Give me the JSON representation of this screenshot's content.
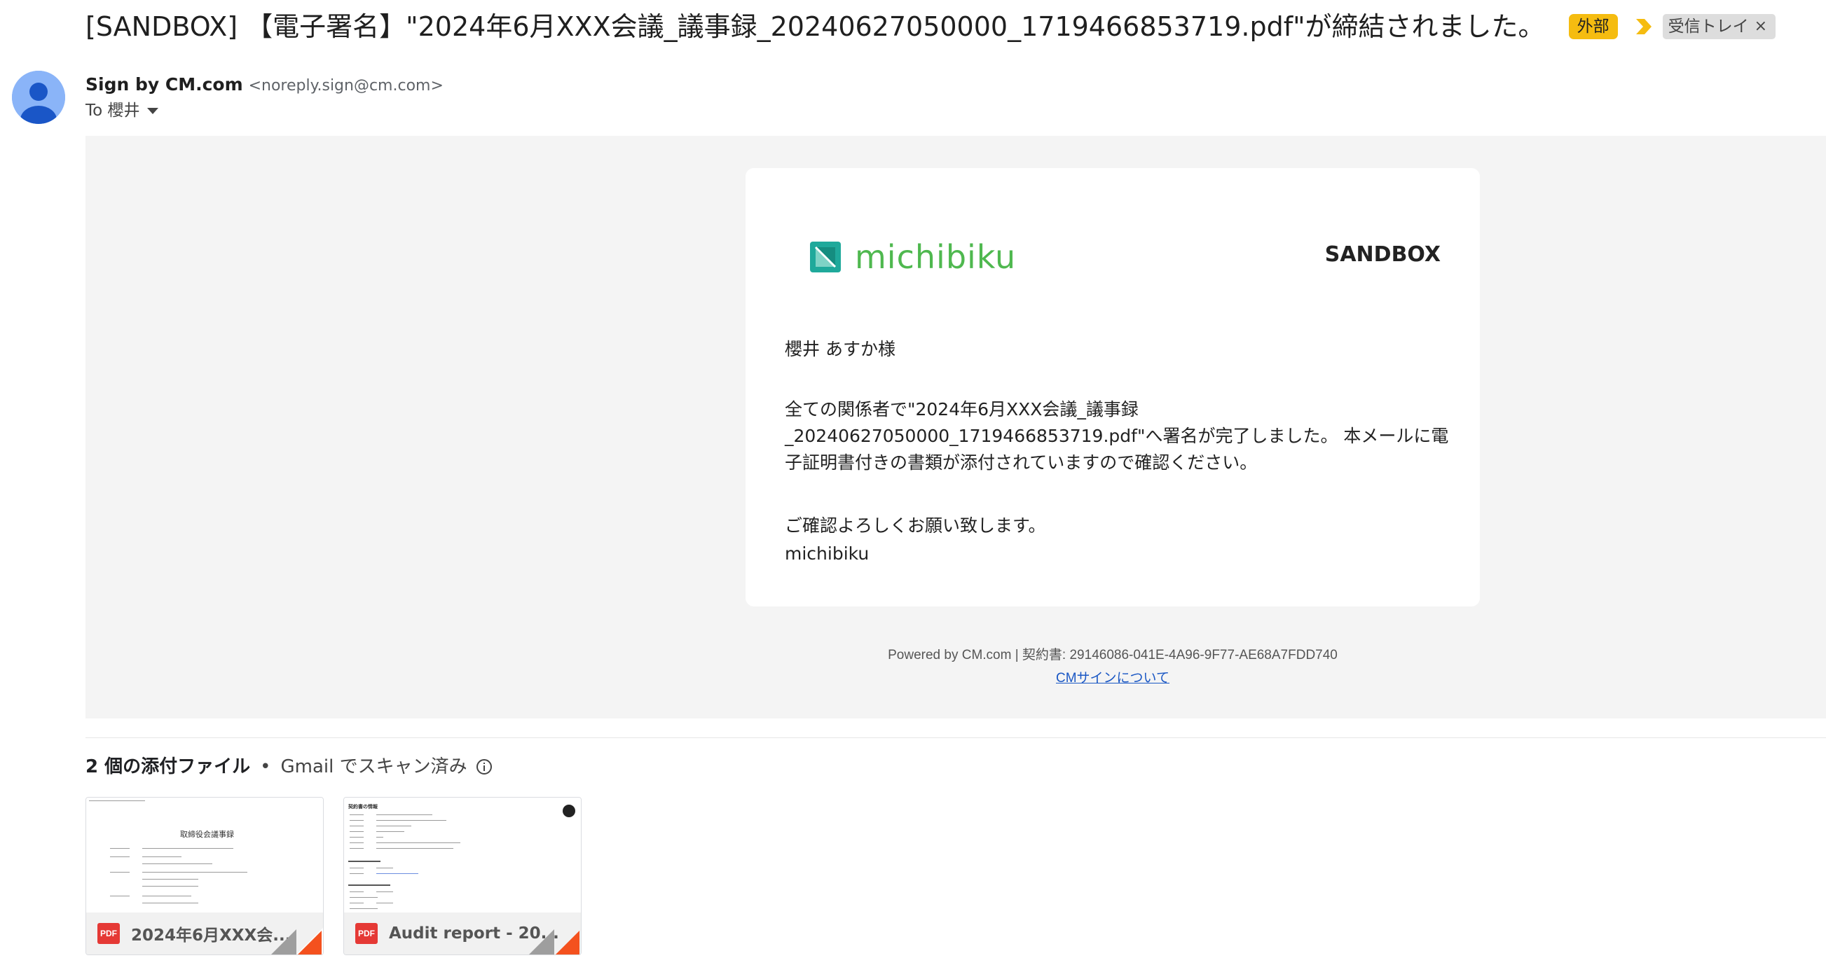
{
  "subject": {
    "text": "[SANDBOX] 【電子署名】\"2024年6月XXX会議_議事録_20240627050000_1719466853719.pdf\"が締結されました。",
    "external_badge": "外部",
    "inbox_label": "受信トレイ",
    "inbox_remove": "×"
  },
  "sender": {
    "name": "Sign by CM.com",
    "email": "<noreply.sign@cm.com>",
    "to": "To 櫻井"
  },
  "email_body": {
    "logo_text": "michibiku",
    "sandbox_label": "SANDBOX",
    "greeting": "櫻井 あすか様",
    "paragraph": "全ての関係者で\"2024年6月XXX会議_議事録_20240627050000_1719466853719.pdf\"へ署名が完了しました。 本メールに電子証明書付きの書類が添付されていますので確認ください。",
    "closing": "ご確認よろしくお願い致します。",
    "signature": "michibiku"
  },
  "footer": {
    "powered": "Powered by CM.com | 契約書: 29146086-041E-4A96-9F77-AE68A7FDD740",
    "link": "CMサインについて"
  },
  "attachments": {
    "count_label": "2 個の添付ファイル",
    "separator": "•",
    "scan_label": "Gmail でスキャン済み",
    "items": [
      {
        "name": "2024年6月XXX会...",
        "type": "PDF",
        "preview_title": "取締役会議事録"
      },
      {
        "name": "Audit report - 20...",
        "type": "PDF",
        "preview_title": "契約書の情報"
      }
    ]
  },
  "colors": {
    "external_badge": "#f5bc10",
    "importance": "#f5bc10",
    "logo_green": "#4fb84f",
    "logo_teal": "#1fa99b",
    "link": "#1a57c4",
    "pdf_red": "#e53935",
    "mail_background": "#f4f4f4"
  },
  "icons": {
    "importance": "importance-marker-icon",
    "avatar": "default-avatar-icon",
    "info": "info-icon",
    "pdf": "pdf-icon",
    "logo": "michibiku-logo-icon"
  }
}
